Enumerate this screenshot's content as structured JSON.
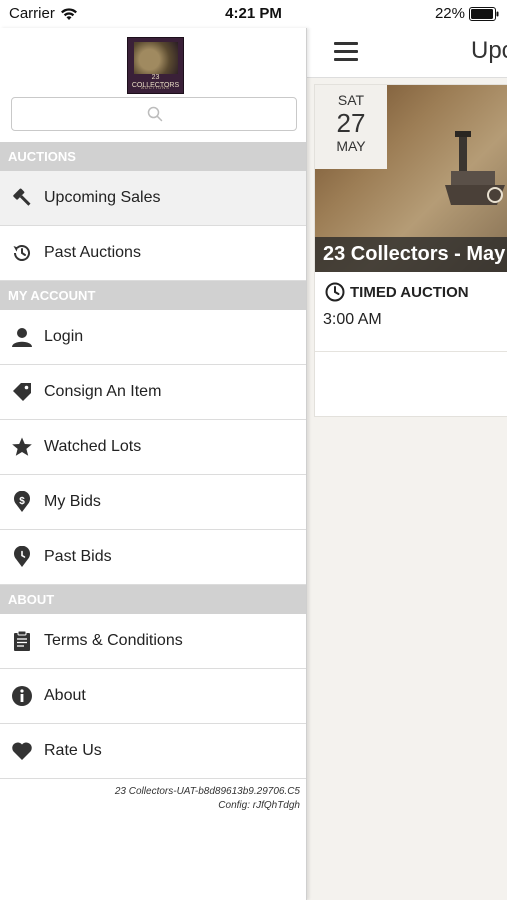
{
  "status_bar": {
    "carrier": "Carrier",
    "time": "4:21 PM",
    "battery": "22%"
  },
  "main": {
    "title": "Upc",
    "card": {
      "dow": "SAT",
      "day": "27",
      "month": "MAY",
      "caption": "23 Collectors - May",
      "type": "TIMED AUCTION",
      "time": "3:00 AM"
    }
  },
  "drawer": {
    "logo": {
      "text": "23 COLLECTORS",
      "sub": "AUCTIONS"
    },
    "search": {
      "placeholder": "",
      "value": ""
    },
    "sections": {
      "auctions": "AUCTIONS",
      "my_account": "MY ACCOUNT",
      "about": "ABOUT"
    },
    "items": [
      {
        "label": "Upcoming Sales",
        "icon": "gavel-icon"
      },
      {
        "label": "Past Auctions",
        "icon": "history-icon"
      },
      {
        "label": "Login",
        "icon": "user-icon"
      },
      {
        "label": "Consign An Item",
        "icon": "tag-icon"
      },
      {
        "label": "Watched Lots",
        "icon": "star-icon"
      },
      {
        "label": "My Bids",
        "icon": "dollar-pin-icon"
      },
      {
        "label": "Past Bids",
        "icon": "clock-pin-icon"
      },
      {
        "label": "Terms & Conditions",
        "icon": "document-icon"
      },
      {
        "label": "About",
        "icon": "info-icon"
      },
      {
        "label": "Rate Us",
        "icon": "heart-icon"
      }
    ],
    "version": "23 Collectors-UAT-b8d89613b9.29706.C5",
    "config": "Config: rJfQhTdgh"
  },
  "colors": {
    "section_header": "#d1d1d1",
    "logo_bg": "#3a2038",
    "caption_bg": "#282828"
  }
}
